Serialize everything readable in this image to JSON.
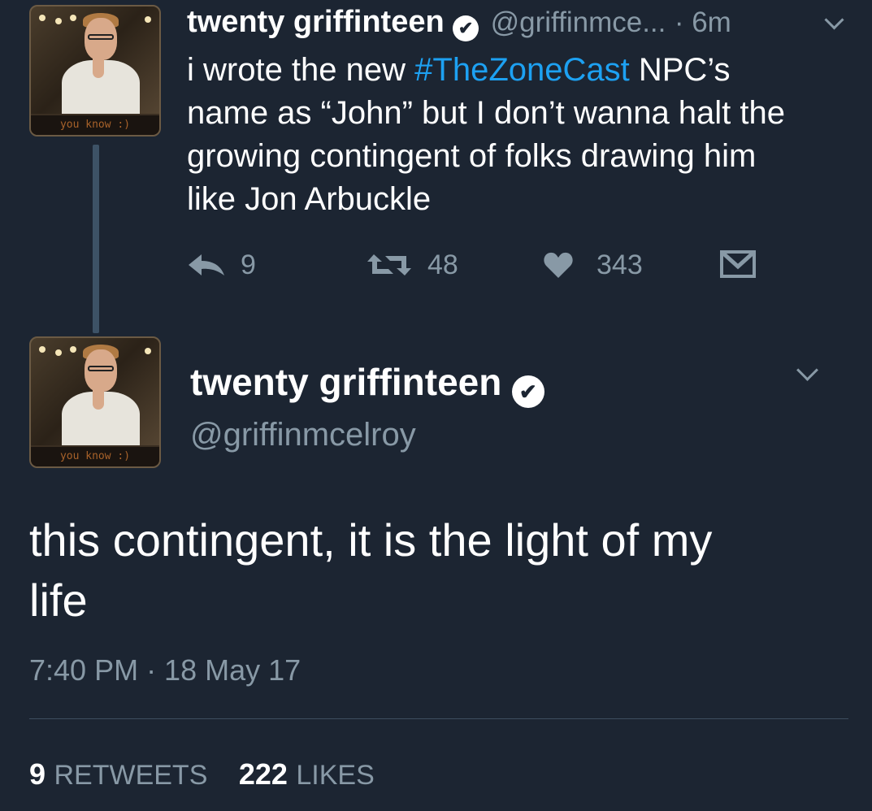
{
  "reply_tweet": {
    "avatar_caption": "you know :)",
    "display_name": "twenty griffinteen",
    "handle": "@griffinmce...",
    "time_ago": "· 6m",
    "text_before_hashtag": "i wrote the new ",
    "hashtag": "#TheZoneCast",
    "text_line1_after": " NPC’s",
    "text_line2": "name as “John” but I don’t wanna halt the",
    "text_line3": "growing contingent of folks drawing him",
    "text_line4": "like Jon Arbuckle",
    "reply_count": "9",
    "retweet_count": "48",
    "like_count": "343"
  },
  "main_tweet": {
    "avatar_caption": "you know :)",
    "display_name": "twenty griffinteen",
    "handle": "@griffinmcelroy",
    "text_line1": "this contingent, it is the light of my",
    "text_line2": "life",
    "timestamp": "7:40 PM · 18 May 17",
    "retweets_count": "9",
    "retweets_label": "RETWEETS",
    "likes_count": "222",
    "likes_label": "LIKES"
  },
  "icons": {
    "verified": "verified-badge-icon",
    "reply": "reply-icon",
    "retweet": "retweet-icon",
    "like": "heart-icon",
    "message": "envelope-icon",
    "menu": "chevron-down-icon"
  },
  "colors": {
    "background": "#1c2532",
    "link": "#1da1f2",
    "muted": "#8899a6"
  }
}
